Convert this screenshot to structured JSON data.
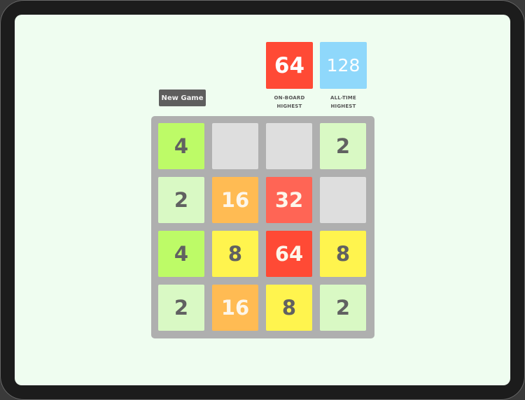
{
  "header": {
    "new_game_label": "New Game",
    "on_board_highest": {
      "value": "64",
      "label_line1": "ON-BOARD",
      "label_line2": "HIGHEST",
      "color": "#ff4a35"
    },
    "all_time_highest": {
      "value": "128",
      "label_line1": "ALL-TIME",
      "label_line2": "HIGHEST",
      "color": "#8fd8fb"
    }
  },
  "board": {
    "size": 4,
    "rows": [
      [
        "4",
        "",
        "",
        "2"
      ],
      [
        "2",
        "16",
        "32",
        ""
      ],
      [
        "4",
        "8",
        "64",
        "8"
      ],
      [
        "2",
        "16",
        "8",
        "2"
      ]
    ]
  },
  "tile_colors": {
    "empty": {
      "bg": "#dedede",
      "fg": "#666666"
    },
    "2": {
      "bg": "#d9f9c4",
      "fg": "#616161"
    },
    "4": {
      "bg": "#bdfb67",
      "fg": "#616161"
    },
    "8": {
      "bg": "#fff44e",
      "fg": "#616161"
    },
    "16": {
      "bg": "#ffbb53",
      "fg": "#fdf6ea"
    },
    "32": {
      "bg": "#ff6555",
      "fg": "#fdf6ea"
    },
    "64": {
      "bg": "#ff4a35",
      "fg": "#fdf6ea"
    }
  }
}
